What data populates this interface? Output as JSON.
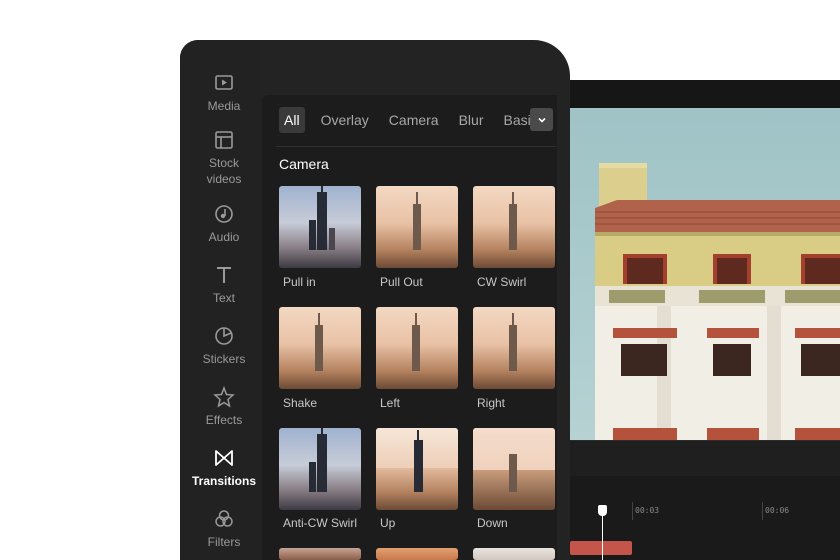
{
  "sidebar": {
    "items": [
      {
        "label": "Media",
        "icon": "media-play-icon"
      },
      {
        "label": "Stock\nvideos",
        "icon": "stock-video-icon"
      },
      {
        "label": "Audio",
        "icon": "audio-icon"
      },
      {
        "label": "Text",
        "icon": "text-icon"
      },
      {
        "label": "Stickers",
        "icon": "sticker-icon"
      },
      {
        "label": "Effects",
        "icon": "effects-star-icon"
      },
      {
        "label": "Transitions",
        "icon": "transitions-bowtie-icon",
        "active": true
      },
      {
        "label": "Filters",
        "icon": "filters-icon"
      }
    ]
  },
  "tabs": {
    "items": [
      "All",
      "Overlay",
      "Camera",
      "Blur",
      "Basic"
    ],
    "active": "All",
    "more_icon": "chevron-down-icon"
  },
  "section": {
    "title": "Camera"
  },
  "transitions": [
    {
      "label": "Pull in",
      "thumb": "cool"
    },
    {
      "label": "Pull Out",
      "thumb": "warm"
    },
    {
      "label": "CW Swirl",
      "thumb": "warm"
    },
    {
      "label": "Shake",
      "thumb": "warm"
    },
    {
      "label": "Left",
      "thumb": "warm"
    },
    {
      "label": "Right",
      "thumb": "warm"
    },
    {
      "label": "Anti-CW Swirl",
      "thumb": "cool"
    },
    {
      "label": "Up",
      "thumb": "split"
    },
    {
      "label": "Down",
      "thumb": "split-down"
    }
  ],
  "timeline": {
    "ticks": [
      "00:03",
      "00:06"
    ]
  },
  "colors": {
    "panel": "#232323",
    "accent_clip": "#c4554a",
    "preview_sky": "#9fc3c6"
  }
}
